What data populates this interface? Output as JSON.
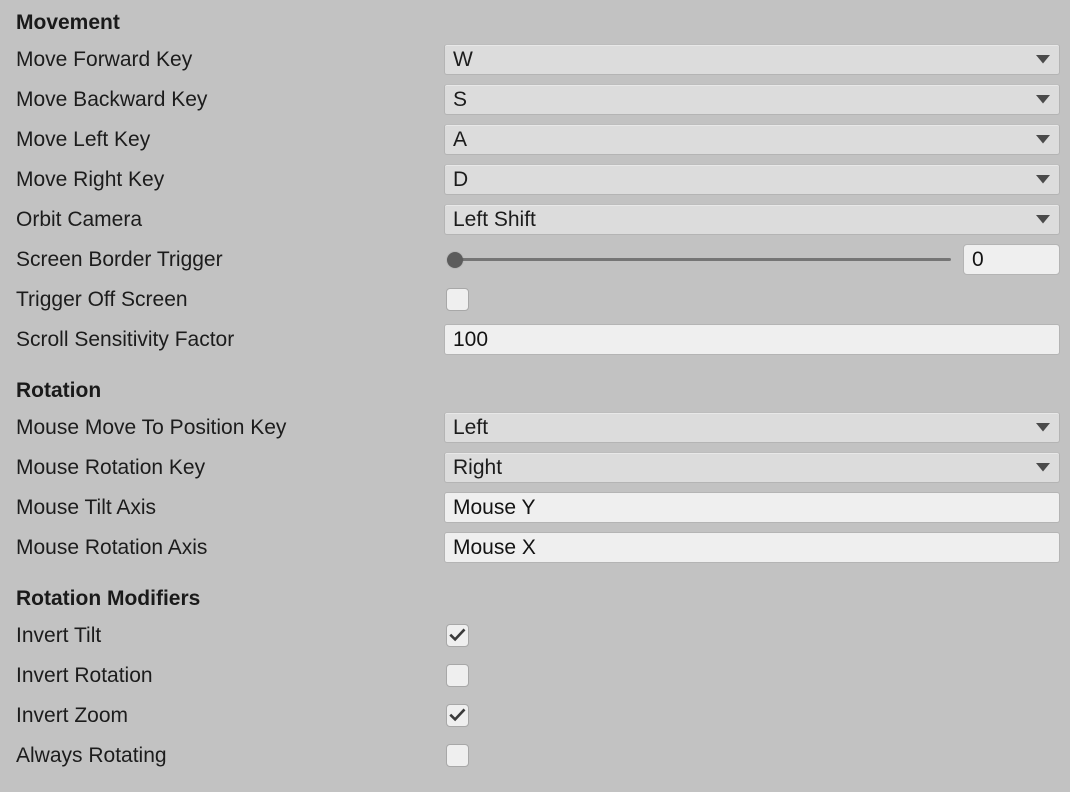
{
  "panel": {
    "background_color": "#c2c2c2",
    "control_fill_dropdown": "#dcdcdc",
    "control_fill_textfield": "#efefef",
    "text_color": "#1c1c1c"
  },
  "sections": [
    {
      "title": "Movement",
      "rows": [
        {
          "label": "Move Forward Key",
          "type": "dropdown",
          "value": "W"
        },
        {
          "label": "Move Backward Key",
          "type": "dropdown",
          "value": "S"
        },
        {
          "label": "Move Left Key",
          "type": "dropdown",
          "value": "A"
        },
        {
          "label": "Move Right Key",
          "type": "dropdown",
          "value": "D"
        },
        {
          "label": "Orbit Camera",
          "type": "dropdown",
          "value": "Left Shift"
        },
        {
          "label": "Screen Border Trigger",
          "type": "slider",
          "value": "0",
          "percent": 0
        },
        {
          "label": "Trigger Off Screen",
          "type": "checkbox",
          "checked": false
        },
        {
          "label": "Scroll Sensitivity Factor",
          "type": "textfield",
          "value": "100"
        }
      ]
    },
    {
      "title": "Rotation",
      "rows": [
        {
          "label": "Mouse Move To Position Key",
          "type": "dropdown",
          "value": "Left"
        },
        {
          "label": "Mouse Rotation Key",
          "type": "dropdown",
          "value": "Right"
        },
        {
          "label": "Mouse Tilt Axis",
          "type": "textfield",
          "value": "Mouse Y"
        },
        {
          "label": "Mouse Rotation Axis",
          "type": "textfield",
          "value": "Mouse X"
        }
      ]
    },
    {
      "title": "Rotation Modifiers",
      "rows": [
        {
          "label": "Invert Tilt",
          "type": "checkbox",
          "checked": true
        },
        {
          "label": "Invert Rotation",
          "type": "checkbox",
          "checked": false
        },
        {
          "label": "Invert Zoom",
          "type": "checkbox",
          "checked": true
        },
        {
          "label": "Always Rotating",
          "type": "checkbox",
          "checked": false
        }
      ]
    }
  ]
}
